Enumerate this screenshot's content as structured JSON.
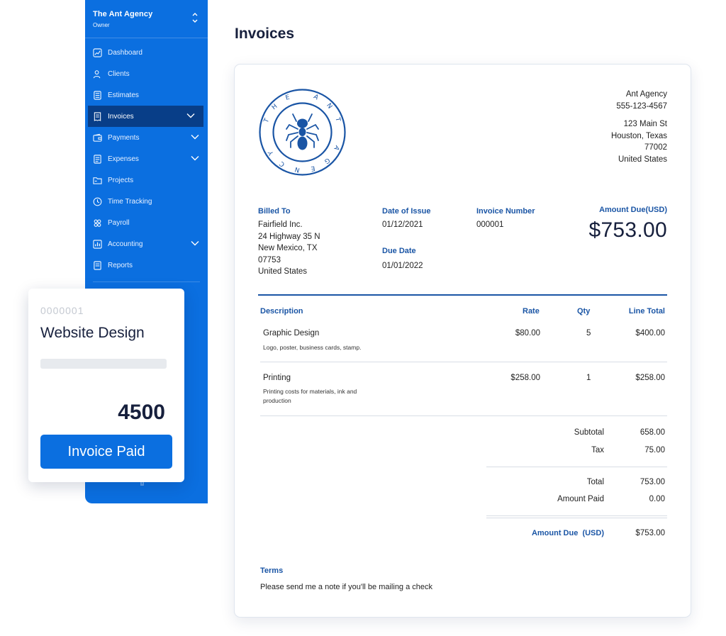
{
  "colors": {
    "brand_blue": "#0b6fe0",
    "active_nav": "#083e88",
    "label_blue": "#1a55a5",
    "ink": "#17203d"
  },
  "sidebar": {
    "org_name": "The Ant Agency",
    "org_role": "Owner",
    "items": [
      {
        "label": "Dashboard",
        "icon": "chart-line-icon"
      },
      {
        "label": "Clients",
        "icon": "people-icon"
      },
      {
        "label": "Estimates",
        "icon": "calculator-icon"
      },
      {
        "label": "Invoices",
        "icon": "receipt-icon",
        "active": true,
        "expandable": true
      },
      {
        "label": "Payments",
        "icon": "wallet-icon",
        "expandable": true
      },
      {
        "label": "Expenses",
        "icon": "document-icon",
        "expandable": true
      },
      {
        "label": "Projects",
        "icon": "folder-icon"
      },
      {
        "label": "Time Tracking",
        "icon": "clock-icon"
      },
      {
        "label": "Payroll",
        "icon": "team-icon"
      },
      {
        "label": "Accounting",
        "icon": "bar-chart-icon",
        "expandable": true
      },
      {
        "label": "Reports",
        "icon": "report-icon"
      }
    ]
  },
  "page": {
    "title": "Invoices"
  },
  "invoice": {
    "company": {
      "name": "Ant Agency",
      "phone": "555-123-4567",
      "street": "123 Main St",
      "city": "Houston, Texas",
      "zip": "77002",
      "country": "United States"
    },
    "logo_text": "THE ANT AGENCY",
    "billed_to": {
      "label": "Billed To",
      "name": "Fairfield Inc.",
      "line1": "24 Highway 35 N",
      "line2": "New Mexico, TX",
      "line3": "07753",
      "line4": "United States"
    },
    "date_of_issue": {
      "label": "Date of Issue",
      "value": "01/12/2021"
    },
    "due_date": {
      "label": "Due Date",
      "value": "01/01/2022"
    },
    "invoice_number": {
      "label": "Invoice Number",
      "value": "000001"
    },
    "amount_due": {
      "label": "Amount Due(USD)",
      "value": "$753.00"
    },
    "columns": {
      "description": "Description",
      "rate": "Rate",
      "qty": "Qty",
      "line_total": "Line Total"
    },
    "items": [
      {
        "name": "Graphic Design",
        "note": "Logo, poster, business cards, stamp.",
        "rate": "$80.00",
        "qty": "5",
        "total": "$400.00"
      },
      {
        "name": "Printing",
        "note": "Printing costs for materials, ink and production",
        "rate": "$258.00",
        "qty": "1",
        "total": "$258.00"
      }
    ],
    "summary": {
      "subtotal_label": "Subtotal",
      "subtotal": "658.00",
      "tax_label": "Tax",
      "tax": "75.00",
      "total_label": "Total",
      "total": "753.00",
      "paid_label": "Amount Paid",
      "paid": "0.00",
      "due_label": "Amount Due  (USD)",
      "due": "$753.00"
    },
    "terms": {
      "label": "Terms",
      "text": "Please send me a note if you'll be mailing a check"
    }
  },
  "paid_card": {
    "number": "0000001",
    "title": "Website Design",
    "amount": "4500",
    "button": "Invoice Paid"
  }
}
